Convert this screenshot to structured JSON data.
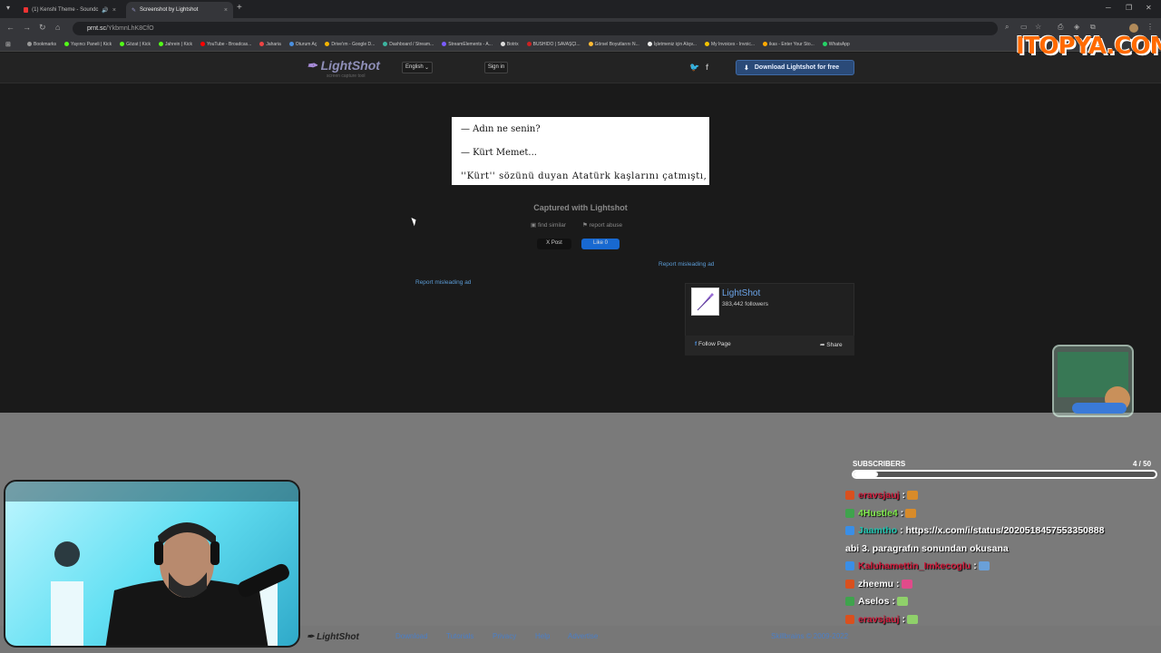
{
  "browser": {
    "tabs": [
      {
        "title": "(1) Kenshi Theme - Soundc",
        "active": false
      },
      {
        "title": "Screenshot by Lightshot",
        "active": true
      }
    ],
    "url_host": "prnt.sc",
    "url_path": "/YkbmnLhK8CfO",
    "bookmarks": [
      "Bookmarks",
      "Yayıncı Paneli | Kick",
      "Gözat | Kick",
      "Jahrein | Kick",
      "YouTube - Broadcas...",
      "Jaharia",
      "Oturum Aç",
      "Drive'ım - Google D...",
      "Dashboard / Stream...",
      "StreamElements - A...",
      "Botrix",
      "BUSHIDO | SAVAŞÇI...",
      "Görsel Boyutlarını N...",
      "İşletmeniz için Alışv...",
      "My Invoices - Invoic...",
      "ikas - Enter Your Sto...",
      "WhatsApp"
    ]
  },
  "lightshot": {
    "logo": "LightShot",
    "tagline": "screen capture tool",
    "language": "English",
    "signin": "Sign in",
    "download_label": "Download Lightshot for free",
    "screenshot_lines": [
      "—   Adın ne senin?",
      "—   Kürt Memet...",
      "''Kürt'' sözünü duyan Atatürk kaşlarını çatmıştı,"
    ],
    "captured": "Captured with Lightshot",
    "find_similar": "find similar",
    "report_abuse": "report abuse",
    "x_post": "X Post",
    "fb_like": "Like 0",
    "report_misleading_1": "Report misleading ad",
    "report_misleading_2": "Report misleading ad",
    "fb_page_name": "LightShot",
    "fb_followers": "383,442 followers",
    "fb_follow": "Follow Page",
    "fb_share": "Share",
    "footer_links": [
      "Download",
      "Tutorials",
      "Privacy",
      "Help",
      "Advertise"
    ],
    "footer_brand": "Skillbrains",
    "footer_years": " © 2009-2022"
  },
  "overlay": {
    "brand": "ITOPYA.COM",
    "subscribers_label": "SUBSCRIBERS",
    "subscribers_count": "4 / 50",
    "subscribers_progress": 0.08,
    "chat": [
      {
        "user": "eravsjauj",
        "text": " :",
        "user_color": "#d01c3c",
        "badge": "#d9501e",
        "emote": "#d88b2a"
      },
      {
        "user": "4Hustle4",
        "text": " :",
        "user_color": "#7fe84b",
        "badge": "#3fa34d",
        "emote": "#d88b2a"
      },
      {
        "user": "Jaamtho",
        "text": " : https://x.com/i/status/2020518457553350888",
        "user_color": "#20c4b0",
        "badge": "#3a8ee6",
        "emote": ""
      },
      {
        "user": "",
        "text": "abi 3. paragrafın sonundan okusana",
        "user_color": "#fff",
        "badge": "",
        "emote": ""
      },
      {
        "user": "Kaluhamettin_Imkecoglu",
        "text": " :",
        "user_color": "#d01c3c",
        "badge": "#3a8ee6",
        "emote": "#6aa0d8"
      },
      {
        "user": "zheemu",
        "text": " :",
        "user_color": "#ffffff",
        "badge": "#d9501e",
        "emote": "#e04b8a"
      },
      {
        "user": "Aselos",
        "text": " :",
        "user_color": "#ffffff",
        "badge": "#3fa34d",
        "emote": "#8fd06a"
      },
      {
        "user": "eravsjauj",
        "text": " :",
        "user_color": "#d01c3c",
        "badge": "#d9501e",
        "emote": "#8fd06a"
      }
    ]
  }
}
